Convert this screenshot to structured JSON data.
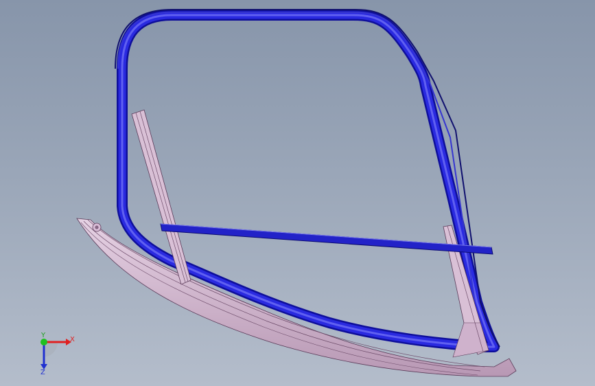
{
  "viewport": {
    "background_top": "#8795aa",
    "background_bottom": "#b4bdcb"
  },
  "model": {
    "parts": [
      {
        "name": "door-frame-seal",
        "color": "#1f1fd8"
      },
      {
        "name": "belt-line-strip",
        "color": "#2a2ad0"
      },
      {
        "name": "front-guide-rail",
        "color": "#c9a8c6"
      },
      {
        "name": "rear-guide-rail",
        "color": "#c9a8c6"
      },
      {
        "name": "lower-sill-rail",
        "color": "#d8bcd6"
      }
    ]
  },
  "triad": {
    "x_label": "X",
    "y_label": "Y",
    "z_label": "Z",
    "x_color": "#e02020",
    "y_color": "#20c020",
    "z_color": "#2030d0"
  }
}
